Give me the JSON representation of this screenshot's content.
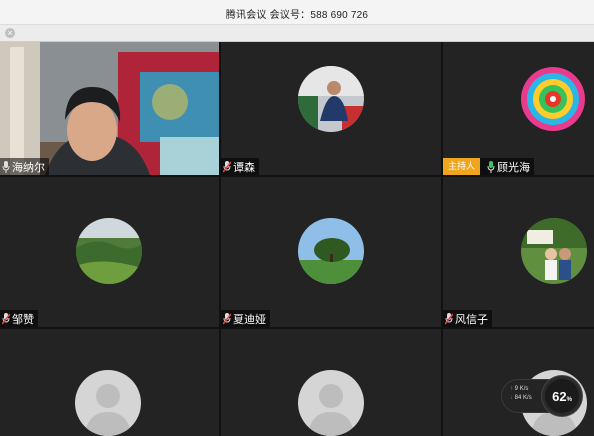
{
  "window": {
    "title": "腾讯会议  会议号：588 690 726"
  },
  "participants": [
    {
      "name": "海纳尔",
      "kind": "video"
    },
    {
      "name": "谭森",
      "kind": "photo"
    },
    {
      "name": "顾光海",
      "kind": "photo",
      "host_label": "主持人"
    },
    {
      "name": "邹赞",
      "kind": "photo"
    },
    {
      "name": "夏迪娅",
      "kind": "photo"
    },
    {
      "name": "风信子",
      "kind": "photo"
    },
    {
      "name": "",
      "kind": "default-avatar"
    },
    {
      "name": "",
      "kind": "default-avatar"
    },
    {
      "name": "",
      "kind": "default-avatar"
    }
  ],
  "network": {
    "upload_value": "9",
    "upload_unit": "K/s",
    "download_value": "84",
    "download_unit": "K/s",
    "cpu_percent": "62",
    "percent_sign": "%"
  },
  "colors": {
    "host_badge": "#f0a51e",
    "tile_bg": "#232323",
    "mic_green": "#3cc46a",
    "mic_muted": "#e04848"
  }
}
